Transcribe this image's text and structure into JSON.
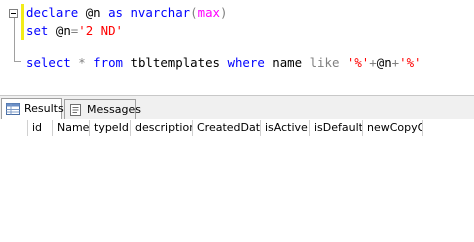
{
  "editor": {
    "line1": {
      "kw1": "declare",
      "var": "@n",
      "kw2": "as",
      "type": "nvarchar",
      "open": "(",
      "fn": "max",
      "close": ")"
    },
    "line2": {
      "kw": "set",
      "var": "@n",
      "eq": "=",
      "str": "'2 ND'"
    },
    "line3": {
      "kw1": "select",
      "star": "*",
      "kw2": "from",
      "table": "tbltemplates",
      "kw3": "where",
      "col": "name",
      "kw4": "like",
      "s1": "'%'",
      "p1": "+",
      "var": "@n",
      "p2": "+",
      "s2": "'%'"
    }
  },
  "tabs": [
    {
      "label": "Results",
      "icon": "results-grid-icon",
      "active": true
    },
    {
      "label": "Messages",
      "icon": "messages-icon",
      "active": false
    }
  ],
  "grid": {
    "columns": [
      "id",
      "Name",
      "typeId",
      "description",
      "CreatedDate",
      "isActive",
      "isDefault",
      "newCopyOf"
    ],
    "rows": []
  },
  "colors": {
    "keyword": "#0000ff",
    "function": "#ff00ff",
    "string": "#ff0000",
    "operator": "#808080",
    "change_bar": "#f2ec18"
  }
}
